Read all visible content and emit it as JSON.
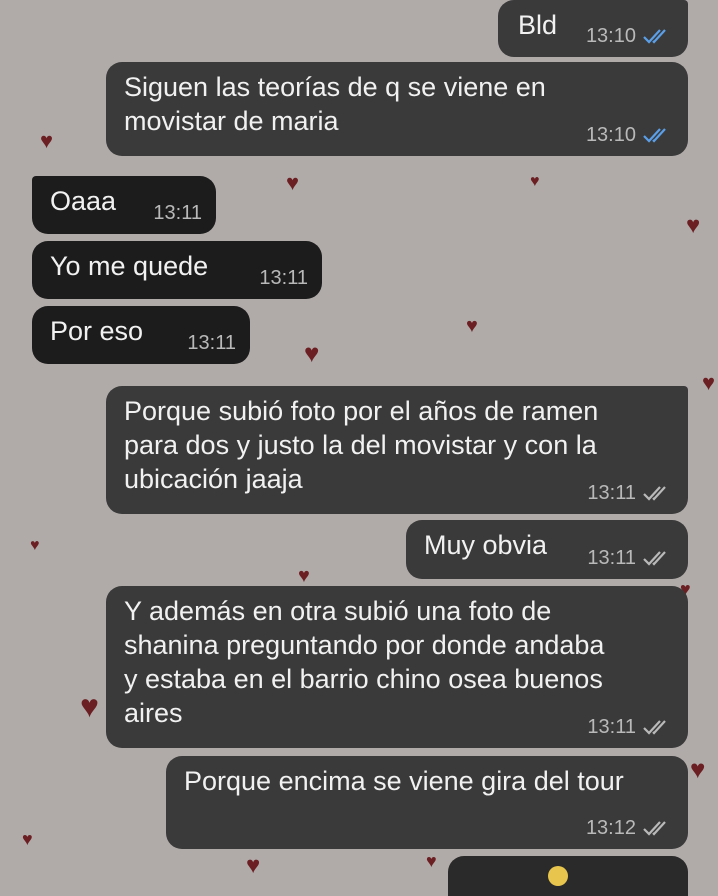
{
  "colors": {
    "background": "#b0aba9",
    "outgoing_bubble": "#3a3a3a",
    "incoming_bubble": "#1c1c1c",
    "read_ticks": "#5a9fe8",
    "sent_ticks": "#b9b9b9",
    "heart": "#6b1f22"
  },
  "messages": [
    {
      "direction": "outgoing",
      "text": "Bld",
      "time": "13:10",
      "status": "read"
    },
    {
      "direction": "outgoing",
      "text": "Siguen las teorías de q se viene en\nmovistar de maria",
      "time": "13:10",
      "status": "read"
    },
    {
      "direction": "incoming",
      "text": "Oaaa",
      "time": "13:11"
    },
    {
      "direction": "incoming",
      "text": "Yo me quede",
      "time": "13:11"
    },
    {
      "direction": "incoming",
      "text": "Por eso",
      "time": "13:11"
    },
    {
      "direction": "outgoing",
      "text": "Porque subió foto por el años de ramen\npara dos y justo la del movistar y con la\nubicación jaaja",
      "time": "13:11",
      "status": "delivered"
    },
    {
      "direction": "outgoing",
      "text": "Muy obvia",
      "time": "13:11",
      "status": "delivered"
    },
    {
      "direction": "outgoing",
      "text": "Y además en otra subió una foto de\nshanina preguntando por donde andaba\ny estaba en el barrio chino osea buenos\naires",
      "time": "13:11",
      "status": "delivered"
    },
    {
      "direction": "outgoing",
      "text": "Porque encima se viene gira del tour",
      "time": "13:12",
      "status": "delivered"
    }
  ],
  "icons": {
    "read": "double-check-icon",
    "delivered": "double-check-icon",
    "background": "heart-icon"
  }
}
